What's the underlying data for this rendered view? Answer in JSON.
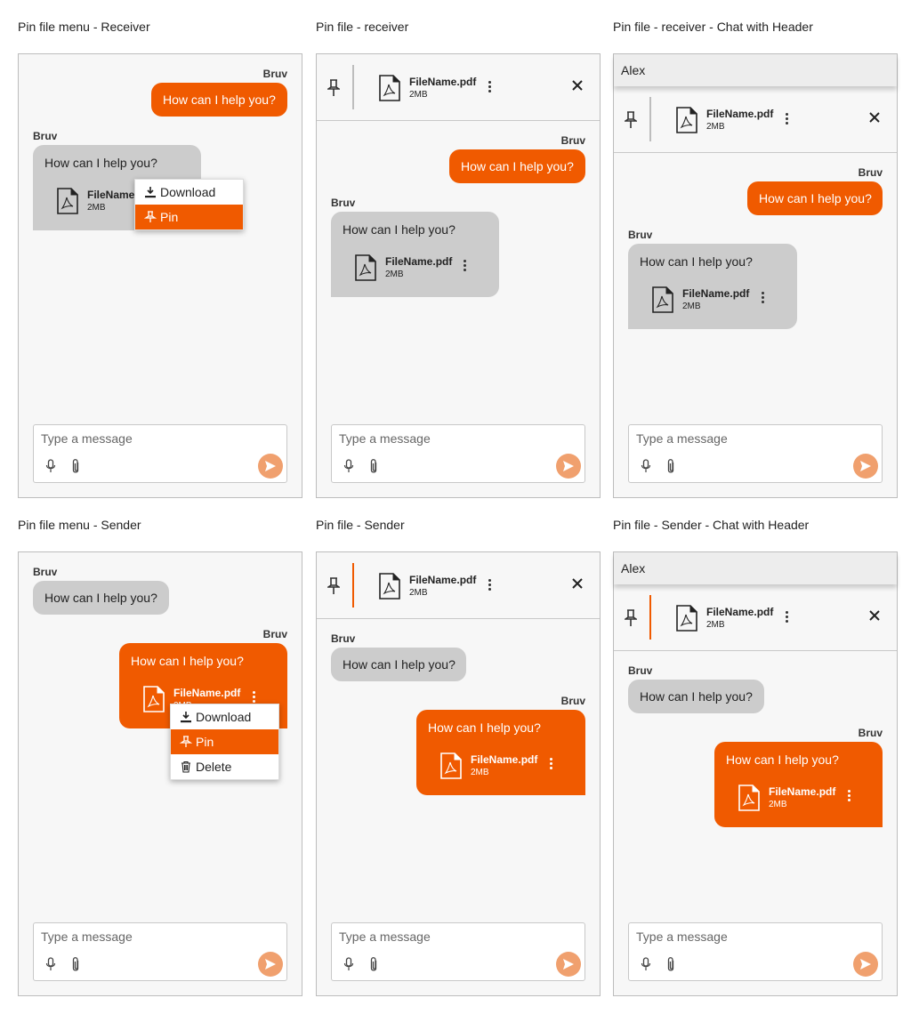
{
  "titles": {
    "p1": "Pin file menu - Receiver",
    "p2": "Pin file - receiver",
    "p3": "Pin file - receiver - Chat with Header",
    "p4": "Pin file menu - Sender",
    "p5": "Pin file - Sender",
    "p6": "Pin file - Sender - Chat with Header"
  },
  "chat": {
    "sender": "Bruv",
    "message": "How can I help you?",
    "header_name": "Alex"
  },
  "file": {
    "name": "FileName.pdf",
    "name_truncated": "FileName.",
    "size": "2MB"
  },
  "menu": {
    "download": "Download",
    "pin": "Pin",
    "delete": "Delete"
  },
  "composer": {
    "placeholder": "Type a message"
  },
  "colors": {
    "accent": "#f05a00",
    "received_bubble": "#cccccc",
    "send_button": "#f0a06e",
    "pin_divider_receiver": "#bdbdbd",
    "pin_divider_sender": "#f05a00"
  },
  "icons": [
    "pdf-file-icon",
    "kebab-menu-icon",
    "pin-icon",
    "close-icon",
    "download-icon",
    "trash-icon",
    "microphone-icon",
    "paperclip-icon",
    "send-icon"
  ]
}
